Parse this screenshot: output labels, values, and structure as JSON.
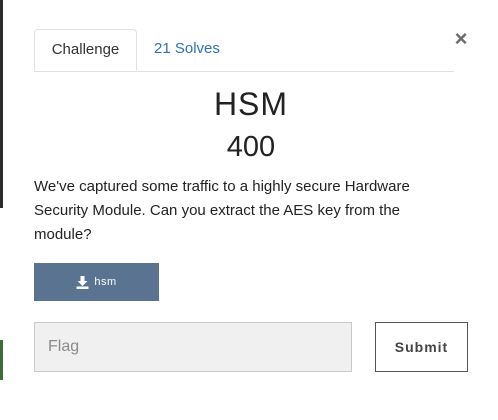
{
  "tabs": {
    "challenge": "Challenge",
    "solves": "21 Solves"
  },
  "close_glyph": "×",
  "challenge": {
    "name": "HSM",
    "value": "400",
    "description": "We've captured some traffic to a highly secure Hardware Security Module. Can you extract the AES key from the module?",
    "file_label": "hsm"
  },
  "form": {
    "flag_placeholder": "Flag",
    "flag_value": "",
    "submit_label": "Submit"
  },
  "colors": {
    "file_button": "#5a7391",
    "link": "#2e72b5",
    "input_bg": "#f0f0f0"
  },
  "icons": {
    "file_button": "download-icon",
    "close": "close-icon"
  }
}
